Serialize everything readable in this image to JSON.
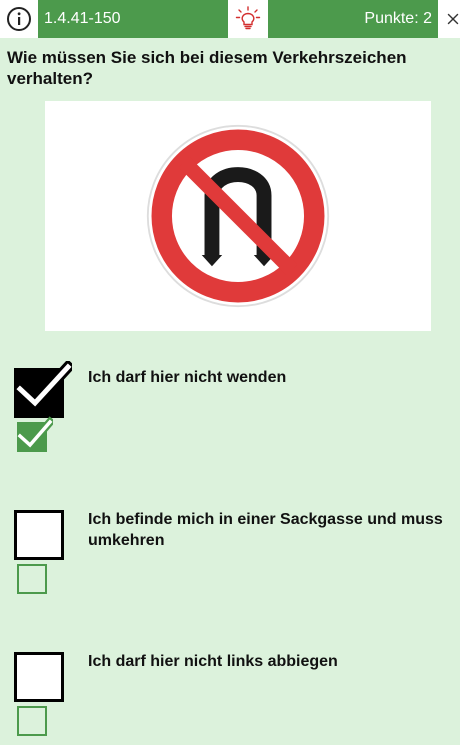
{
  "header": {
    "question_id": "1.4.41-150",
    "points": "Punkte: 2"
  },
  "question": {
    "text": "Wie müssen Sie sich bei diesem Verkehrszeichen verhalten?"
  },
  "sign": {
    "icon": "no-u-turn-sign-icon",
    "ring_color": "#e03a3a",
    "symbol_color": "#1a1a1a"
  },
  "answers": [
    {
      "text": "Ich darf hier nicht wenden",
      "user_checked": true,
      "correct": true
    },
    {
      "text": "Ich befinde mich in einer Sackgasse und muss umkehren",
      "user_checked": false,
      "correct": false
    },
    {
      "text": "Ich darf hier nicht links abbiegen",
      "user_checked": false,
      "correct": false
    }
  ],
  "colors": {
    "accent_green": "#4c9a4c",
    "background": "#dcf2dc",
    "hint_red": "#d32f2f"
  }
}
